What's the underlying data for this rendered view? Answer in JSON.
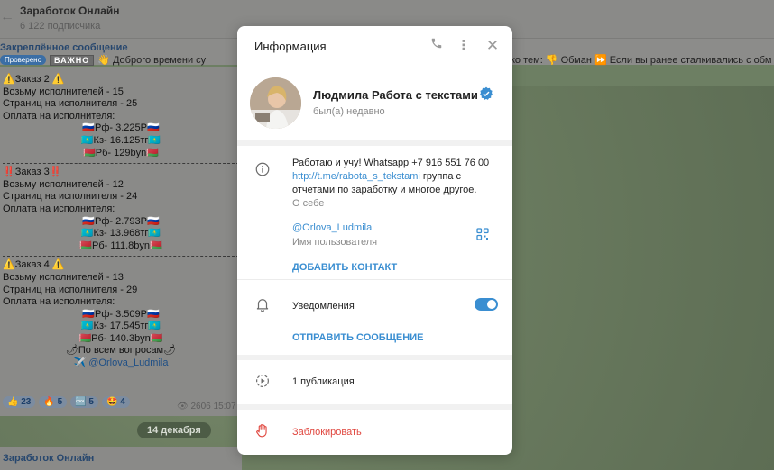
{
  "chat": {
    "title": "Заработок Онлайн",
    "subscribers": "6 122 подписчика",
    "back_icon": "arrow-left-icon"
  },
  "pinned": {
    "title": "Закреплённое сообщение",
    "badge_verified": "Проверено",
    "badge_important": "ВАЖНО",
    "preview": "👋 Доброго времени су",
    "right_text": "ко тем: 👎 Обман ⏩ Если вы ранее сталкивались с обм"
  },
  "message": {
    "lines": [
      {
        "text": "⚠️Заказ 2 ⚠️",
        "center": false
      },
      {
        "text": "Возьму исполнителей - 15",
        "center": false
      },
      {
        "text": "Страниц на исполнителя - 25",
        "center": false
      },
      {
        "text": "Оплата на исполнителя:",
        "center": false
      },
      {
        "text": "🇷🇺Рф- 3.225Р🇷🇺",
        "center": true
      },
      {
        "text": "🇰🇿Кз- 16.125тг🇰🇿",
        "center": true
      },
      {
        "text": "🇧🇾Рб- 129byn🇧🇾",
        "center": true
      },
      {
        "text": "",
        "sep": true
      },
      {
        "text": "‼️Заказ 3‼️",
        "center": false
      },
      {
        "text": "Возьму исполнителей - 12",
        "center": false
      },
      {
        "text": "Страниц на исполнителя - 24",
        "center": false
      },
      {
        "text": "Оплата на исполнителя:",
        "center": false
      },
      {
        "text": "🇷🇺Рф- 2.793Р🇷🇺",
        "center": true
      },
      {
        "text": "🇰🇿Кз- 13.968тг🇰🇿",
        "center": true
      },
      {
        "text": "🇧🇾Рб- 111.8byn🇧🇾",
        "center": true
      },
      {
        "text": "",
        "sep": true
      },
      {
        "text": "⚠️Заказ 4 ⚠️",
        "center": false
      },
      {
        "text": "Возьму исполнителей - 13",
        "center": false
      },
      {
        "text": "Страниц на исполнителя - 29",
        "center": false
      },
      {
        "text": "Оплата на исполнителя:",
        "center": false
      },
      {
        "text": "🇷🇺Рф- 3.509Р🇷🇺",
        "center": true
      },
      {
        "text": "🇰🇿Кз- 17.545тг🇰🇿",
        "center": true
      },
      {
        "text": "🇧🇾Рб- 140.3byn🇧🇾",
        "center": true
      },
      {
        "text": "🌶По всем вопросам🌶",
        "center": true
      },
      {
        "text": "✈️ @Orlova_Ludmila",
        "center": true,
        "link": true
      }
    ],
    "reactions": [
      {
        "emoji": "👍",
        "count": "23"
      },
      {
        "emoji": "🔥",
        "count": "5"
      },
      {
        "emoji": "🆒",
        "count": "5"
      },
      {
        "emoji": "🤩",
        "count": "4"
      }
    ],
    "views": "👁 2606",
    "time": "15:07"
  },
  "date_pill": "14 декабря",
  "message2": {
    "title": "Заработок Онлайн"
  },
  "modal": {
    "title": "Информация",
    "icons": {
      "phone": "phone-icon",
      "more": "more-vertical-icon",
      "close": "close-icon"
    },
    "profile": {
      "name": "Людмила Работа с текстами",
      "status": "был(а) недавно",
      "verified_color": "#3a8ed1"
    },
    "bio": {
      "text_before_link": "Работаю и учу! Whatsapp +7 916 551 76 00",
      "link": "http://t.me/rabota_s_tekstami",
      "text_after_link": " группа с отчетами по заработку и многое другое.",
      "caption": "О себе"
    },
    "username": {
      "value": "@Orlova_Ludmila",
      "caption": "Имя пользователя"
    },
    "add_contact": "ДОБАВИТЬ КОНТАКТ",
    "notifications": {
      "label": "Уведомления",
      "enabled": true
    },
    "send_message": "ОТПРАВИТЬ СООБЩЕНИЕ",
    "publications": "1 публикация",
    "block": "Заблокировать",
    "accent_color": "#3a8ed1",
    "danger_color": "#e0473f"
  }
}
